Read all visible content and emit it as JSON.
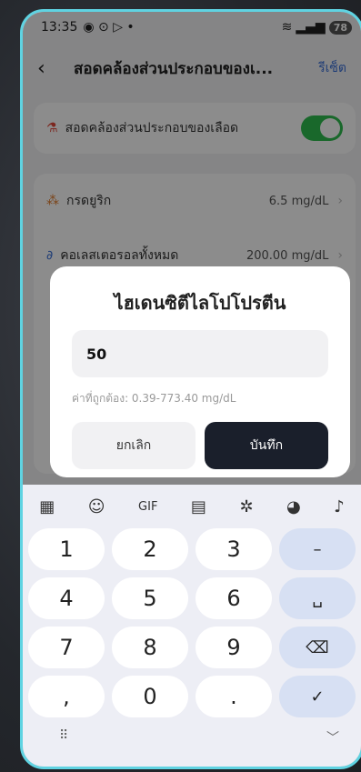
{
  "status": {
    "time": "13:35",
    "battery": "78"
  },
  "appbar": {
    "back_icon": "‹",
    "title": "สอดคล้องส่วนประกอบของเ...",
    "reset": "รีเซ็ต"
  },
  "blood": {
    "label": "สอดคล้องส่วนประกอบของเลือด",
    "toggle_on": true
  },
  "items": [
    {
      "label": "กรดยูริก",
      "value": "6.5 mg/dL"
    },
    {
      "label": "คอเลสเตอรอลทั้งหมด",
      "value": "200.00 mg/dL"
    }
  ],
  "dialog": {
    "title": "ไฮเดนซิตีไลโปโปรตีน",
    "input_value": "50",
    "range": "ค่าที่ถูกต้อง: 0.39-773.40 mg/dL",
    "cancel": "ยกเลิก",
    "save": "บันทึก"
  },
  "keyboard": {
    "toolbar": [
      "grid-icon",
      "sticker-icon",
      "GIF",
      "clipboard-icon",
      "settings-icon",
      "palette-icon",
      "mic-icon"
    ],
    "gif_label": "GIF",
    "keys": [
      "1",
      "2",
      "3",
      "–",
      "4",
      "5",
      "6",
      "␣",
      "7",
      "8",
      "9",
      "⌫",
      ",",
      "0",
      ".",
      "✓"
    ]
  }
}
